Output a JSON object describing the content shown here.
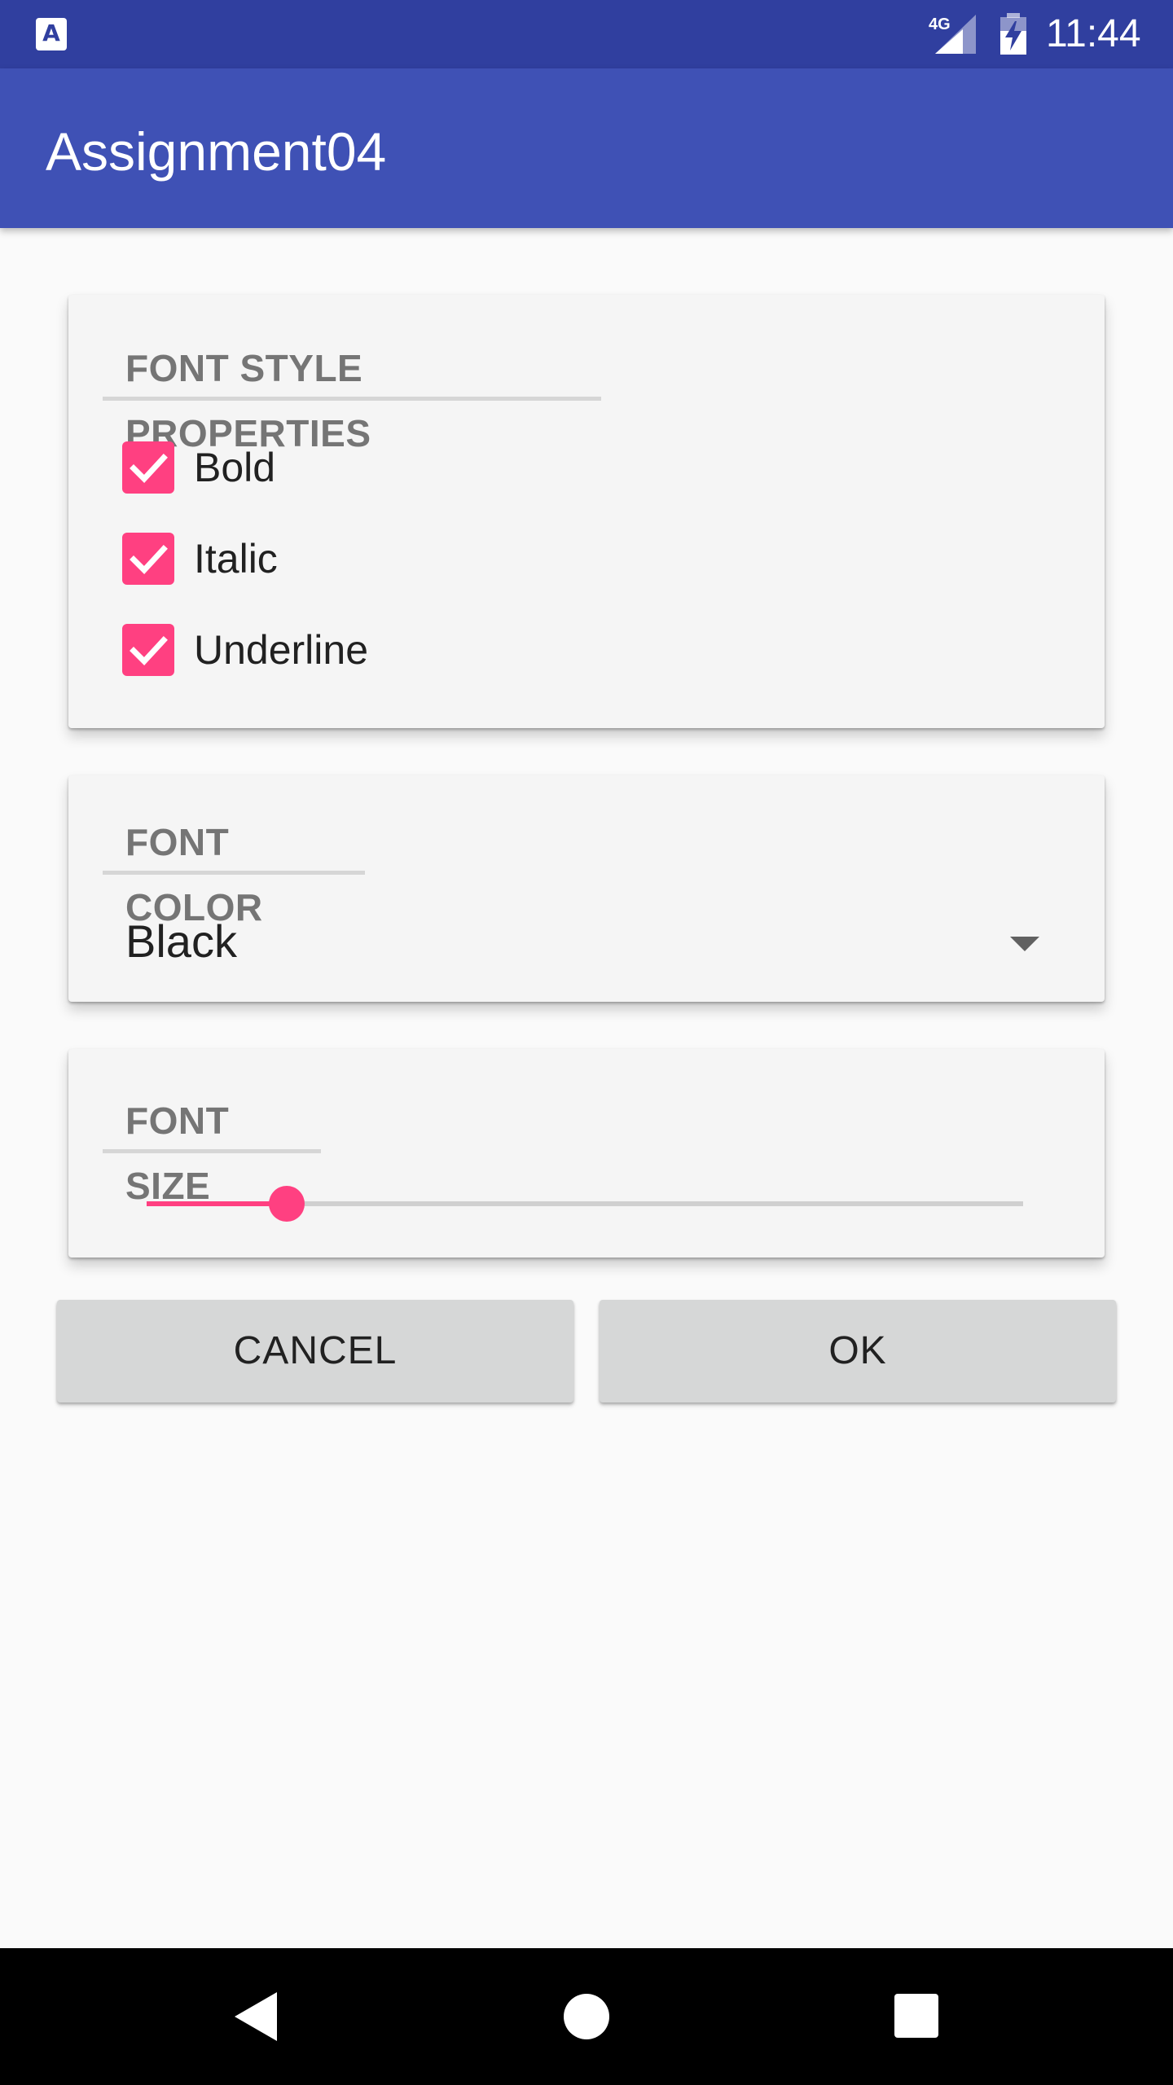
{
  "status_bar": {
    "time": "11:44",
    "network": "4G",
    "icons": [
      "app-notification-icon",
      "signal-icon",
      "battery-charging-icon"
    ]
  },
  "app_bar": {
    "title": "Assignment04",
    "color": "#3f51b5"
  },
  "font_style": {
    "header": "FONT STYLE PROPERTIES",
    "options": [
      {
        "label": "Bold",
        "checked": true
      },
      {
        "label": "Italic",
        "checked": true
      },
      {
        "label": "Underline",
        "checked": true
      }
    ]
  },
  "font_color": {
    "header": "FONT COLOR",
    "selected": "Black"
  },
  "font_size": {
    "header": "FONT SIZE",
    "slider_fraction": 0.16
  },
  "buttons": {
    "cancel": "CANCEL",
    "ok": "OK"
  },
  "accent_color": "#ff4081",
  "nav_bar": {
    "icons": [
      "back-icon",
      "home-icon",
      "recents-icon"
    ]
  }
}
